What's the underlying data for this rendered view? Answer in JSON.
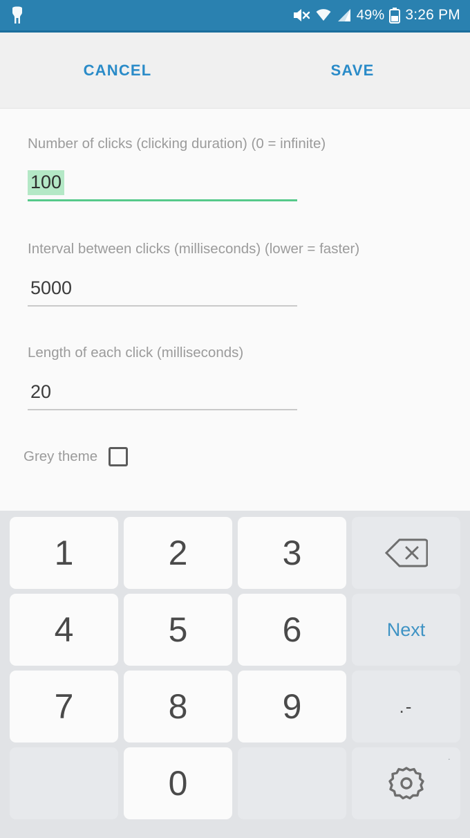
{
  "status_bar": {
    "notification_icon": "app-notification-icon",
    "mute_icon": "sound-off-icon",
    "wifi_icon": "wifi-icon",
    "signal_icon": "cellular-signal-icon",
    "battery_percent": "49%",
    "battery_icon": "battery-icon",
    "clock": "3:26 PM",
    "background_color": "#2a81b0"
  },
  "action_bar": {
    "cancel_label": "CANCEL",
    "save_label": "SAVE",
    "accent_color": "#2a8bc8"
  },
  "form": {
    "fields": [
      {
        "label": "Number of clicks (clicking duration) (0 = infinite)",
        "value": "100",
        "focused": true,
        "selected": true,
        "underline_color": "#55c98a",
        "selection_color": "#b4e8c6"
      },
      {
        "label": "Interval between clicks (milliseconds) (lower = faster)",
        "value": "5000",
        "focused": false,
        "selected": false,
        "underline_color": "#c9c9c9"
      },
      {
        "label": "Length of each click (milliseconds)",
        "value": "20",
        "focused": false,
        "selected": false,
        "underline_color": "#c9c9c9"
      }
    ],
    "checkbox": {
      "label": "Grey theme",
      "checked": false
    }
  },
  "keyboard": {
    "background_color": "#e1e3e6",
    "rows": [
      [
        {
          "label": "1",
          "type": "digit",
          "name": "key-1"
        },
        {
          "label": "2",
          "type": "digit",
          "name": "key-2"
        },
        {
          "label": "3",
          "type": "digit",
          "name": "key-3"
        },
        {
          "label": "",
          "type": "func",
          "name": "backspace-key",
          "icon": "backspace-icon"
        }
      ],
      [
        {
          "label": "4",
          "type": "digit",
          "name": "key-4"
        },
        {
          "label": "5",
          "type": "digit",
          "name": "key-5"
        },
        {
          "label": "6",
          "type": "digit",
          "name": "key-6"
        },
        {
          "label": "Next",
          "type": "next-key",
          "name": "next-key"
        }
      ],
      [
        {
          "label": "7",
          "type": "digit",
          "name": "key-7"
        },
        {
          "label": "8",
          "type": "digit",
          "name": "key-8"
        },
        {
          "label": "9",
          "type": "digit",
          "name": "key-9"
        },
        {
          "label": ".-",
          "type": "punct",
          "name": "period-dash-key"
        }
      ],
      [
        {
          "label": "",
          "type": "blank",
          "name": "blank-key-left"
        },
        {
          "label": "0",
          "type": "digit",
          "name": "key-0"
        },
        {
          "label": "",
          "type": "blank",
          "name": "blank-key-right"
        },
        {
          "label": "",
          "type": "func",
          "name": "keyboard-settings-key",
          "icon": "gear-icon",
          "corner_dot": "·"
        }
      ]
    ]
  }
}
